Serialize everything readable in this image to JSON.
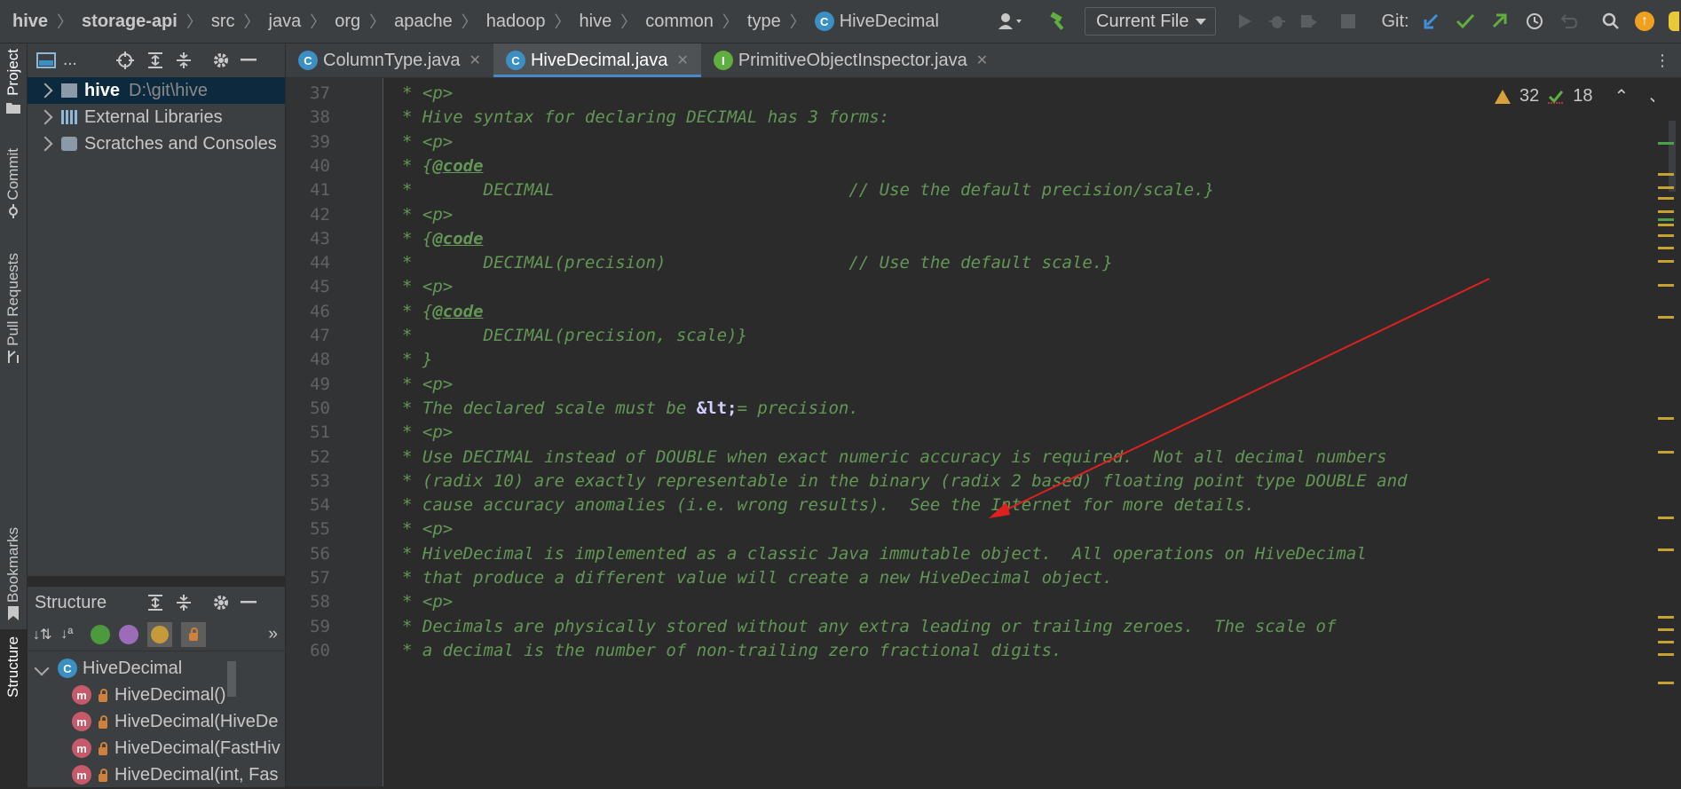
{
  "breadcrumbs": [
    {
      "label": "hive",
      "bold": true
    },
    {
      "label": "storage-api",
      "bold": true
    },
    {
      "label": "src"
    },
    {
      "label": "java"
    },
    {
      "label": "org"
    },
    {
      "label": "apache"
    },
    {
      "label": "hadoop"
    },
    {
      "label": "hive"
    },
    {
      "label": "common"
    },
    {
      "label": "type"
    },
    {
      "label": "HiveDecimal",
      "icon": "class-icon"
    }
  ],
  "toolbar": {
    "run_config": "Current File",
    "git_label": "Git:"
  },
  "left_strip": {
    "project": "Project",
    "commit": "Commit",
    "pull_requests": "Pull Requests",
    "bookmarks": "Bookmarks",
    "structure": "Structure"
  },
  "project_panel": {
    "title": "...",
    "items": [
      {
        "label": "hive",
        "path": "D:\\git\\hive",
        "selected": true
      },
      {
        "label": "External Libraries"
      },
      {
        "label": "Scratches and Consoles"
      }
    ]
  },
  "structure_panel": {
    "title": "Structure",
    "root": "HiveDecimal",
    "members": [
      "HiveDecimal()",
      "HiveDecimal(HiveDe",
      "HiveDecimal(FastHiv",
      "HiveDecimal(int, Fas"
    ]
  },
  "editor_tabs": [
    {
      "label": "ColumnType.java",
      "icon": "class-icon",
      "active": false
    },
    {
      "label": "HiveDecimal.java",
      "icon": "class-icon",
      "active": true
    },
    {
      "label": "PrimitiveObjectInspector.java",
      "icon": "interface-icon",
      "active": false
    }
  ],
  "inspections": {
    "warnings": "32",
    "typos": "18"
  },
  "code_lines": [
    {
      "n": "37",
      "text": "* <p>"
    },
    {
      "n": "38",
      "text": "* Hive syntax for declaring DECIMAL has 3 forms:"
    },
    {
      "n": "39",
      "text": "* <p>"
    },
    {
      "n": "40",
      "pre": "* {",
      "tag": "@code",
      "post": ""
    },
    {
      "n": "41",
      "text": "*       DECIMAL                             // Use the default precision/scale.}"
    },
    {
      "n": "42",
      "text": "* <p>"
    },
    {
      "n": "43",
      "pre": "* {",
      "tag": "@code",
      "post": ""
    },
    {
      "n": "44",
      "text": "*       DECIMAL(precision)                  // Use the default scale.}"
    },
    {
      "n": "45",
      "text": "* <p>"
    },
    {
      "n": "46",
      "pre": "* {",
      "tag": "@code",
      "post": ""
    },
    {
      "n": "47",
      "text": "*       DECIMAL(precision, scale)}"
    },
    {
      "n": "48",
      "text": "* }"
    },
    {
      "n": "49",
      "text": "* <p>"
    },
    {
      "n": "50",
      "pre": "* The declared scale must be ",
      "ent": "&lt;",
      "post": "= precision."
    },
    {
      "n": "51",
      "text": "* <p>"
    },
    {
      "n": "52",
      "text": "* Use DECIMAL instead of DOUBLE when exact numeric accuracy is required.  Not all decimal numbers"
    },
    {
      "n": "53",
      "text": "* (radix 10) are exactly representable in the binary (radix 2 based) floating point type DOUBLE and"
    },
    {
      "n": "54",
      "text": "* cause accuracy anomalies (i.e. wrong results).  See the Internet for more details."
    },
    {
      "n": "55",
      "text": "* <p>"
    },
    {
      "n": "56",
      "text": "* HiveDecimal is implemented as a classic Java immutable object.  All operations on HiveDecimal"
    },
    {
      "n": "57",
      "text": "* that produce a different value will create a new HiveDecimal object."
    },
    {
      "n": "58",
      "text": "* <p>"
    },
    {
      "n": "59",
      "text": "* Decimals are physically stored without any extra leading or trailing zeroes.  The scale of"
    },
    {
      "n": "60",
      "text": "* a decimal is the number of non-trailing zero fractional digits."
    }
  ],
  "colors": {
    "comment": "#629755",
    "accent": "#4a88c7",
    "annotation_arrow": "#e0201f"
  }
}
